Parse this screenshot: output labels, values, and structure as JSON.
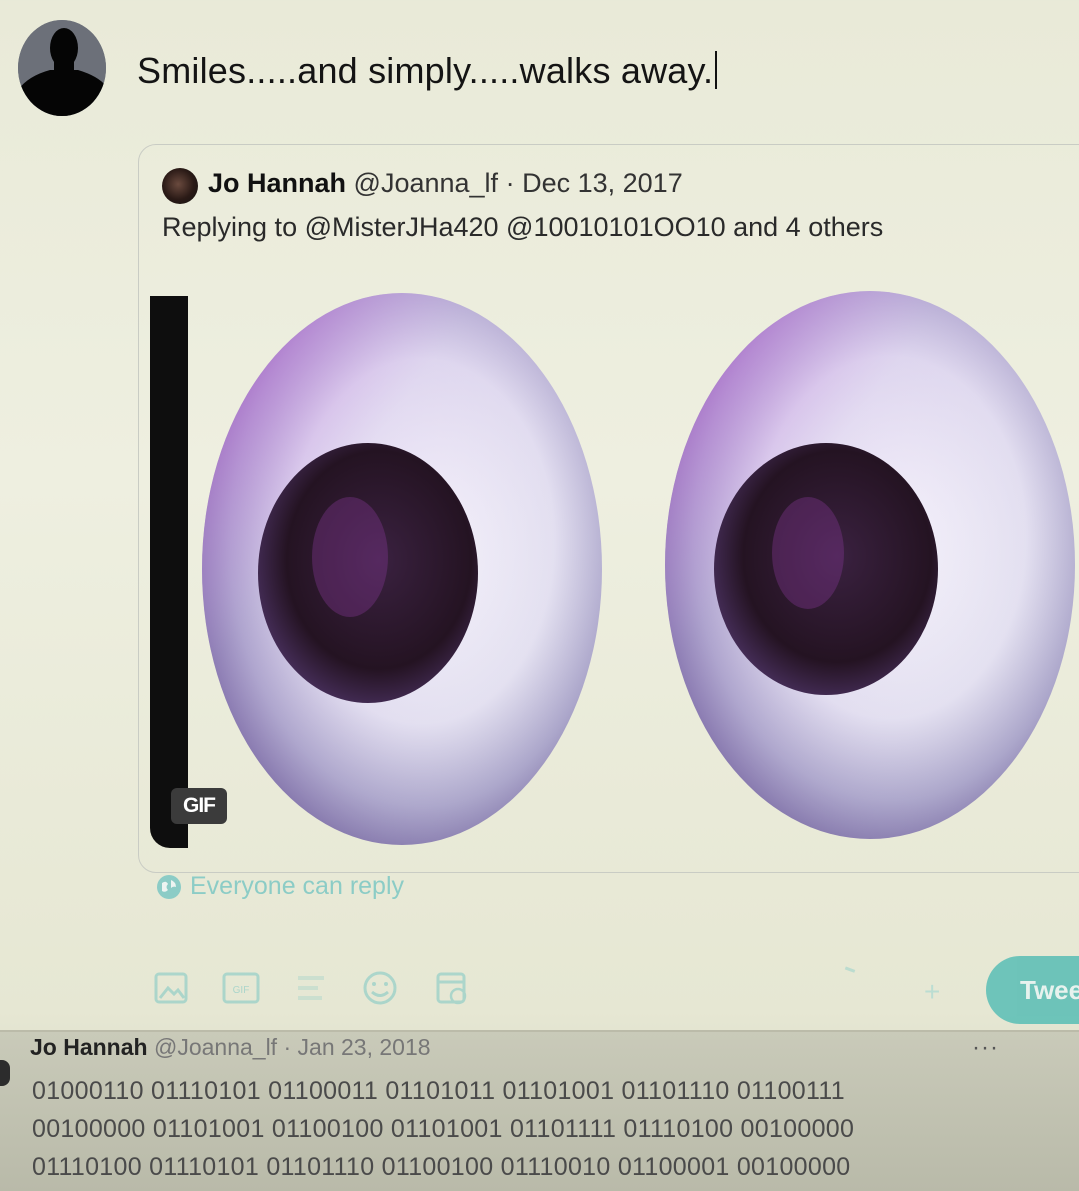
{
  "compose": {
    "text": "Smiles.....and simply.....walks away."
  },
  "quoted_tweet": {
    "name": "Jo Hannah",
    "handle": "@Joanna_lf",
    "separator": "·",
    "date": "Dec 13, 2017",
    "replying_to": "Replying to @MisterJHa420 @10010101OO10 and 4 others",
    "media_badge": "GIF",
    "media_icon": "eyes-gif"
  },
  "reply_setting": {
    "label": "Everyone can reply",
    "icon": "globe-icon",
    "color": "#7cc8c4"
  },
  "toolbar": {
    "icons": [
      "image-icon",
      "gif-icon",
      "poll-icon",
      "emoji-icon",
      "schedule-icon",
      "add-icon"
    ],
    "tweet_button_label": "Twee",
    "accent": "#58bdb5"
  },
  "timeline_tweet": {
    "name": "Jo Hannah",
    "handle": "@Joanna_lf",
    "separator": "·",
    "date": "Jan 23, 2018",
    "more": "···",
    "lines": [
      "01000110 01110101 01100011 01101011 01101001 01101110 01100111",
      "00100000 01101001 01100100 01101001 01101111 01110100 00100000",
      "01110100 01110101 01101110 01100100 01110010 01100001 00100000"
    ]
  }
}
